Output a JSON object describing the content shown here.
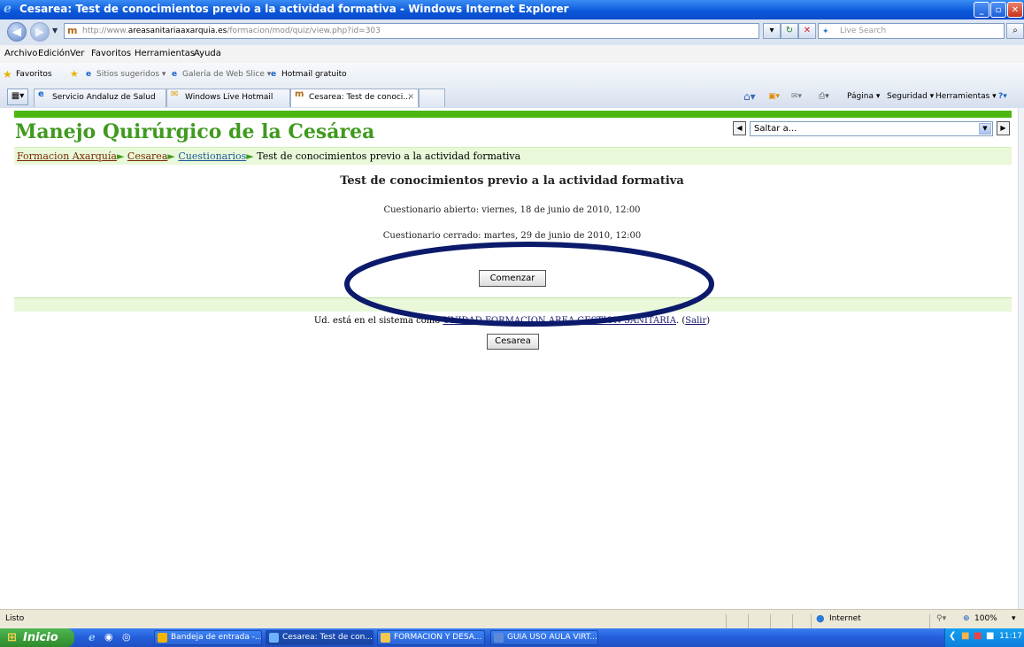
{
  "window": {
    "title": "Cesarea: Test de conocimientos previo a la actividad formativa - Windows Internet Explorer",
    "minimize": "_",
    "maximize": "▫",
    "close": "✕"
  },
  "address_bar": {
    "url_prefix": "http://www.",
    "url_host": "areasanitariaaxarquia.es",
    "url_path": "/formacion/mod/quiz/view.php?id=303",
    "search_placeholder": "Live Search"
  },
  "menu": [
    "Archivo",
    "Edición",
    "Ver",
    "Favoritos",
    "Herramientas",
    "Ayuda"
  ],
  "favorites_bar": {
    "favorites_label": "Favoritos",
    "items": [
      "Sitios sugeridos ▾",
      "Galería de Web Slice ▾",
      "Hotmail gratuito"
    ]
  },
  "tabs": [
    {
      "label": "Servicio Andaluz de Salud"
    },
    {
      "label": "Windows Live Hotmail"
    },
    {
      "label": "Cesarea: Test de conoci..."
    }
  ],
  "command_bar": [
    "Página ▾",
    "Seguridad ▾",
    "Herramientas ▾"
  ],
  "page": {
    "site_title": "Manejo Quirúrgico de la Cesárea",
    "jump_placeholder": "Saltar a...",
    "breadcrumb": [
      {
        "label": "Formacion Axarquía",
        "link": true
      },
      {
        "label": "Cesarea",
        "link": true
      },
      {
        "label": "Cuestionarios",
        "link": true
      },
      {
        "label": "Test de conocimientos previo a la actividad formativa",
        "link": false
      }
    ],
    "breadcrumb_sep": "►",
    "quiz_title": "Test de conocimientos previo a la actividad formativa",
    "quiz_open": "Cuestionario abierto: viernes, 18 de junio de 2010, 12:00",
    "quiz_close": "Cuestionario cerrado: martes, 29 de junio de 2010, 12:00",
    "start_button": "Comenzar",
    "login_prefix": "Ud. está en el sistema como ",
    "login_user": "UNIDAD FORMACION AREA GESTION SANITARIA",
    "login_mid": ". (",
    "logout": "Salir",
    "login_suffix": ")",
    "course_button": "Cesarea"
  },
  "status_bar": {
    "status": "Listo",
    "zone": "Internet",
    "zoom": "100%"
  },
  "taskbar": {
    "start": "Inicio",
    "items": [
      {
        "label": "Bandeja de entrada -..."
      },
      {
        "label": "Cesarea: Test de con..."
      },
      {
        "label": "FORMACION Y DESA..."
      },
      {
        "label": "GUIA USO AULA VIRT..."
      }
    ],
    "clock": "11:17"
  },
  "colors": {
    "site_green": "#3f9a1e",
    "highlight_ellipse": "#0c1a6b"
  }
}
